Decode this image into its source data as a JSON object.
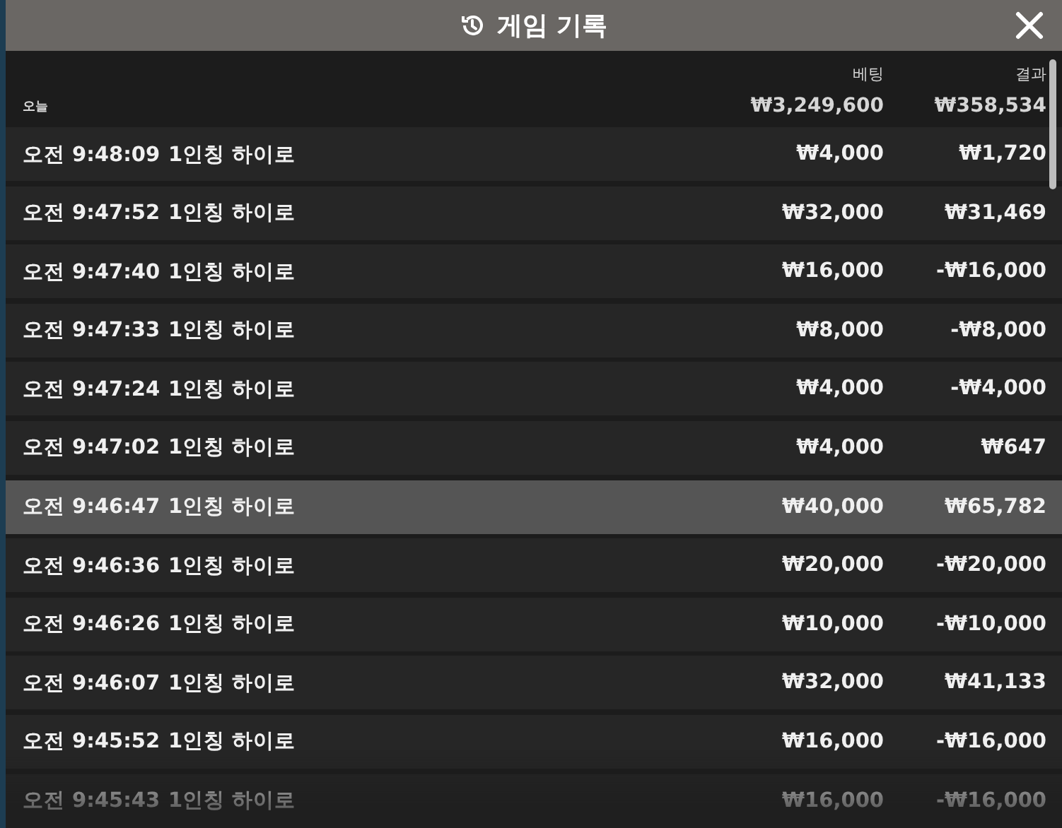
{
  "window": {
    "title": "게임 기록"
  },
  "columns": {
    "bet": "베팅",
    "result": "결과"
  },
  "summary": {
    "label": "오늘",
    "bet": "₩3,249,600",
    "result": "₩358,534"
  },
  "rows": [
    {
      "time": "오전 9:48:09",
      "game": "1인칭 하이로",
      "bet": "₩4,000",
      "result": "₩1,720",
      "selected": false
    },
    {
      "time": "오전 9:47:52",
      "game": "1인칭 하이로",
      "bet": "₩32,000",
      "result": "₩31,469",
      "selected": false
    },
    {
      "time": "오전 9:47:40",
      "game": "1인칭 하이로",
      "bet": "₩16,000",
      "result": "-₩16,000",
      "selected": false
    },
    {
      "time": "오전 9:47:33",
      "game": "1인칭 하이로",
      "bet": "₩8,000",
      "result": "-₩8,000",
      "selected": false
    },
    {
      "time": "오전 9:47:24",
      "game": "1인칭 하이로",
      "bet": "₩4,000",
      "result": "-₩4,000",
      "selected": false
    },
    {
      "time": "오전 9:47:02",
      "game": "1인칭 하이로",
      "bet": "₩4,000",
      "result": "₩647",
      "selected": false
    },
    {
      "time": "오전 9:46:47",
      "game": "1인칭 하이로",
      "bet": "₩40,000",
      "result": "₩65,782",
      "selected": true
    },
    {
      "time": "오전 9:46:36",
      "game": "1인칭 하이로",
      "bet": "₩20,000",
      "result": "-₩20,000",
      "selected": false
    },
    {
      "time": "오전 9:46:26",
      "game": "1인칭 하이로",
      "bet": "₩10,000",
      "result": "-₩10,000",
      "selected": false
    },
    {
      "time": "오전 9:46:07",
      "game": "1인칭 하이로",
      "bet": "₩32,000",
      "result": "₩41,133",
      "selected": false
    },
    {
      "time": "오전 9:45:52",
      "game": "1인칭 하이로",
      "bet": "₩16,000",
      "result": "-₩16,000",
      "selected": false
    },
    {
      "time": "오전 9:45:43",
      "game": "1인칭 하이로",
      "bet": "₩16,000",
      "result": "-₩16,000",
      "selected": false
    }
  ]
}
